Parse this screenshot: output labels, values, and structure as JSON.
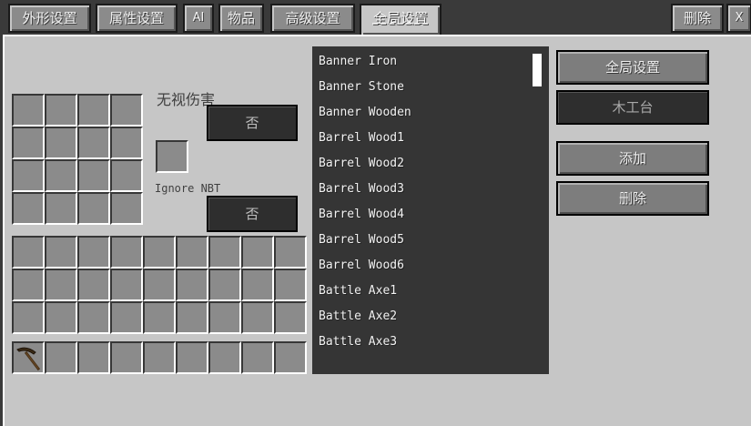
{
  "tabs": {
    "appearance": "外形设置",
    "attributes": "属性设置",
    "ai": "AI",
    "items": "物品",
    "advanced": "高级设置",
    "global": "全局设置",
    "delete": "删除",
    "close": "X"
  },
  "options": {
    "ignore_damage_label": "无视伤害",
    "ignore_damage_value": "否",
    "ignore_nbt_label": "Ignore NBT",
    "ignore_nbt_value": "否"
  },
  "list": {
    "items": [
      "Banner Iron",
      "Banner Stone",
      "Banner Wooden",
      "Barrel Wood1",
      "Barrel Wood2",
      "Barrel Wood3",
      "Barrel Wood4",
      "Barrel Wood5",
      "Barrel Wood6",
      "Battle Axe1",
      "Battle Axe2",
      "Battle Axe3"
    ]
  },
  "side": {
    "global_settings": "全局设置",
    "workbench": "木工台",
    "add": "添加",
    "delete": "删除"
  },
  "hotbar": {
    "slot1_item_icon": "pickaxe-icon"
  }
}
